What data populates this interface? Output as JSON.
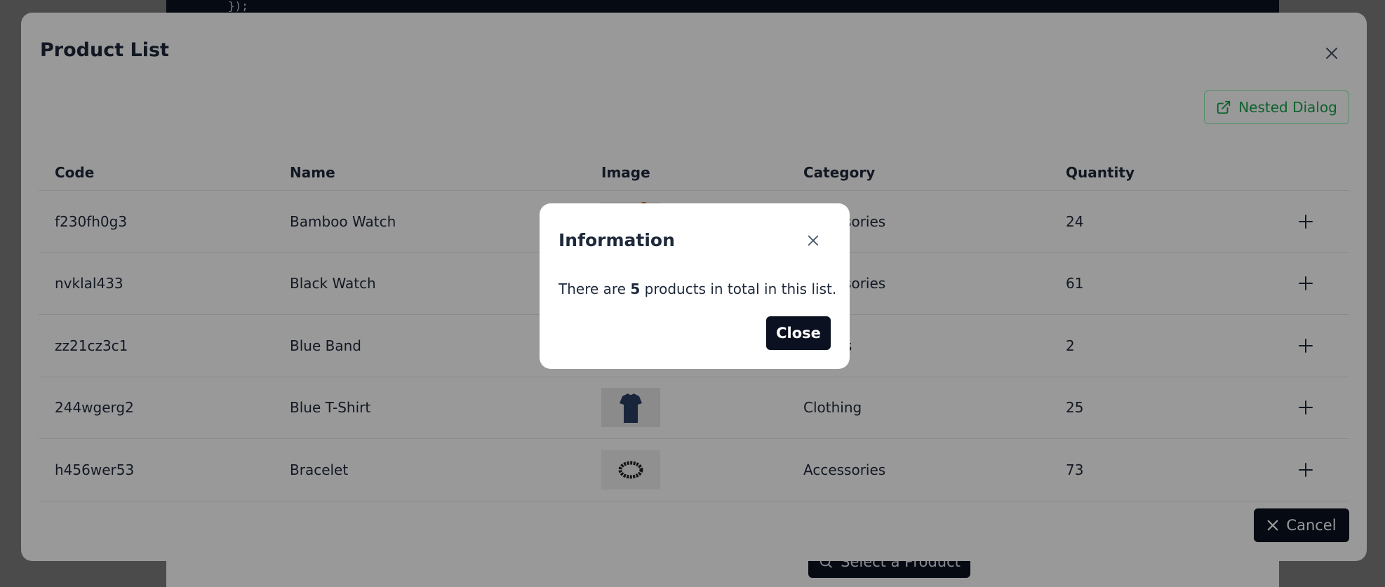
{
  "background": {
    "code_snippet": "});",
    "select_button_label": "Select a Product"
  },
  "dialog": {
    "title": "Product List",
    "nested_button_label": "Nested Dialog",
    "cancel_label": "Cancel",
    "columns": [
      "Code",
      "Name",
      "Image",
      "Category",
      "Quantity"
    ],
    "rows": [
      {
        "code": "f230fh0g3",
        "name": "Bamboo Watch",
        "image": "watch",
        "category": "Accessories",
        "quantity": "24"
      },
      {
        "code": "nvklal433",
        "name": "Black Watch",
        "image": "black-watch",
        "category": "Accessories",
        "quantity": "61"
      },
      {
        "code": "zz21cz3c1",
        "name": "Blue Band",
        "image": "band",
        "category": "Fitness",
        "quantity": "2"
      },
      {
        "code": "244wgerg2",
        "name": "Blue T-Shirt",
        "image": "tshirt",
        "category": "Clothing",
        "quantity": "25"
      },
      {
        "code": "h456wer53",
        "name": "Bracelet",
        "image": "bracelet",
        "category": "Accessories",
        "quantity": "73"
      }
    ]
  },
  "info_dialog": {
    "title": "Information",
    "message_prefix": "There are",
    "count": "5",
    "message_suffix": "products in total in this list.",
    "close_label": "Close"
  },
  "colors": {
    "accent_green": "#16a34a",
    "dark_button": "#0b1120"
  }
}
